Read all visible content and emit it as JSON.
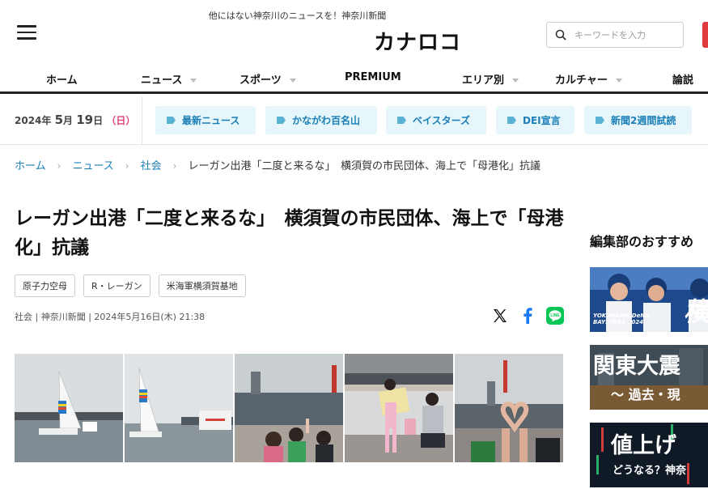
{
  "header": {
    "tagline": "他にはない神奈川のニュースを！神奈川新聞",
    "logo": "カナロコ",
    "search_placeholder": "キーワードを入力"
  },
  "nav": {
    "items": [
      {
        "label": "ホーム",
        "caret": false
      },
      {
        "label": "ニュース",
        "caret": true
      },
      {
        "label": "スポーツ",
        "caret": true
      },
      {
        "label": "PREMIUM",
        "caret": false
      },
      {
        "label": "エリア別",
        "caret": true
      },
      {
        "label": "カルチャー",
        "caret": true
      },
      {
        "label": "論説",
        "caret": false
      }
    ]
  },
  "date": {
    "year": "2024",
    "year_unit": "年",
    "month": "5",
    "month_unit": "月",
    "day": "19",
    "day_unit": "日",
    "weekday": "（日）"
  },
  "quick_tags": [
    "最新ニュース",
    "かながわ百名山",
    "ベイスターズ",
    "DEI宣言",
    "新聞2週間試読"
  ],
  "breadcrumb": {
    "home": "ホーム",
    "news": "ニュース",
    "society": "社会",
    "current": "レーガン出港「二度と来るな」　横須賀の市民団体、海上で「母港化」抗議"
  },
  "article": {
    "title": "レーガン出港「二度と来るな」　横須賀の市民団体、海上で「母港化」抗議",
    "tags": [
      "原子力空母",
      "R・レーガン",
      "米海軍横須賀基地"
    ],
    "meta": "社会 | 神奈川新聞 | 2024年5月16日(木) 21:38"
  },
  "sidebar": {
    "title": "編集部のおすすめ",
    "banner1": "YOKOHAMA DeNA BAYSTARS 2024",
    "banner1_char": "横",
    "banner2_line1": "関東大震",
    "banner2_line2": "〜 過去・現",
    "banner3_line1": "値上げ",
    "banner3_line2": "どうなる？神奈"
  },
  "colors": {
    "link": "#1b7fb7",
    "tag_bg": "#e6f6fa",
    "sunday": "#e0467a",
    "search_button": "#e0393e",
    "line_green": "#06c755",
    "facebook_blue": "#1877f2"
  }
}
